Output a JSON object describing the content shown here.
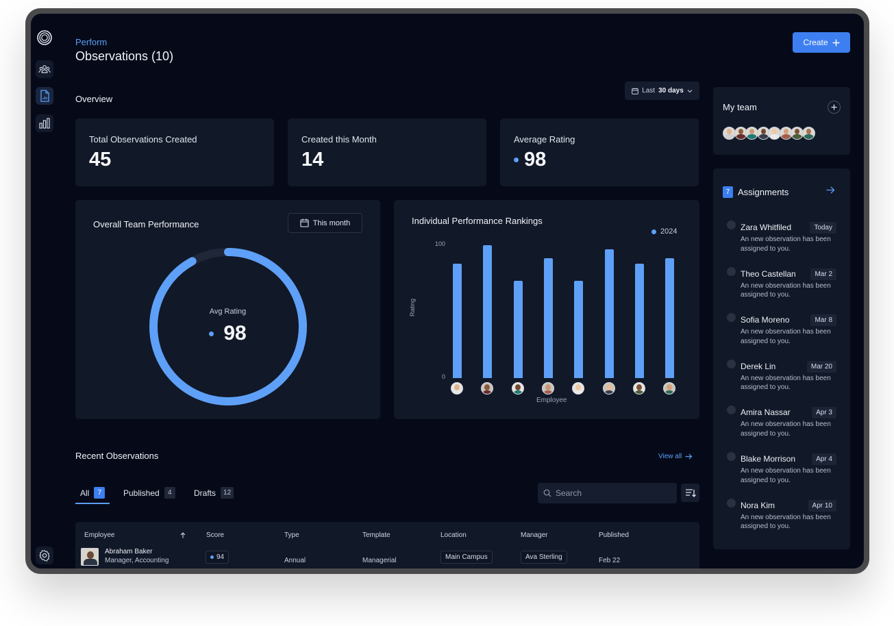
{
  "header": {
    "section": "Perform",
    "title": "Observations (10)",
    "create_label": "Create"
  },
  "overview": {
    "title": "Overview",
    "range_prefix": "Last",
    "range_value": "30 days"
  },
  "stats": [
    {
      "label": "Total Observations Created",
      "value": "45"
    },
    {
      "label": "Created this Month",
      "value": "14"
    },
    {
      "label": "Average Rating",
      "value": "98"
    }
  ],
  "team_performance": {
    "title": "Overall Team Performance",
    "period_label": "This month",
    "avg_label": "Avg Rating",
    "avg_value": "98",
    "ring_fraction": 0.92,
    "colors": {
      "accent": "#5ea0f7",
      "track": "#1f2738"
    }
  },
  "chart_data": {
    "type": "bar",
    "title": "Individual Performance Rankings",
    "xlabel": "Employee",
    "ylabel": "Rating",
    "ylim": [
      0,
      100
    ],
    "y_ticks": [
      "0",
      "100"
    ],
    "series": [
      {
        "name": "2024",
        "values": [
          86,
          100,
          73,
          90,
          73,
          97,
          86,
          90
        ]
      }
    ],
    "legend_position": "top-right",
    "bar_color": "#5ea0f7"
  },
  "recent": {
    "title": "Recent Observations",
    "view_all": "View all",
    "tabs": [
      {
        "label": "All",
        "count": "7"
      },
      {
        "label": "Published",
        "count": "4"
      },
      {
        "label": "Drafts",
        "count": "12"
      }
    ],
    "search_placeholder": "Search",
    "columns": [
      "Employee",
      "Score",
      "Type",
      "Template",
      "Location",
      "Manager",
      "Published"
    ],
    "rows": [
      {
        "name": "Abraham Baker",
        "role": "Manager, Accounting",
        "score": "94",
        "type": "Annual",
        "template": "Managerial",
        "location": "Main Campus",
        "manager": "Ava Sterling",
        "published": "Feb 22"
      }
    ]
  },
  "my_team": {
    "title": "My team"
  },
  "assignments": {
    "count": "7",
    "title": "Assignments",
    "items": [
      {
        "name": "Zara Whitfiled",
        "date": "Today",
        "desc": "An new observation has been assigned to you."
      },
      {
        "name": "Theo Castellan",
        "date": "Mar 2",
        "desc": "An new observation has been assigned to you."
      },
      {
        "name": "Sofia Moreno",
        "date": "Mar 8",
        "desc": "An new observation has been assigned to you."
      },
      {
        "name": "Derek Lin",
        "date": "Mar 20",
        "desc": "An new observation has been assigned to you."
      },
      {
        "name": "Amira Nassar",
        "date": "Apr 3",
        "desc": "An new observation has been assigned to you."
      },
      {
        "name": "Blake Morrison",
        "date": "Apr 4",
        "desc": "An new observation has been assigned to you."
      },
      {
        "name": "Nora Kim",
        "date": "Apr 10",
        "desc": "An new observation has been assigned to you."
      }
    ]
  },
  "sidebar": {
    "icons": [
      "logo-icon",
      "team-icon",
      "document-chart-icon",
      "bar-chart-icon",
      "settings-icon"
    ]
  }
}
